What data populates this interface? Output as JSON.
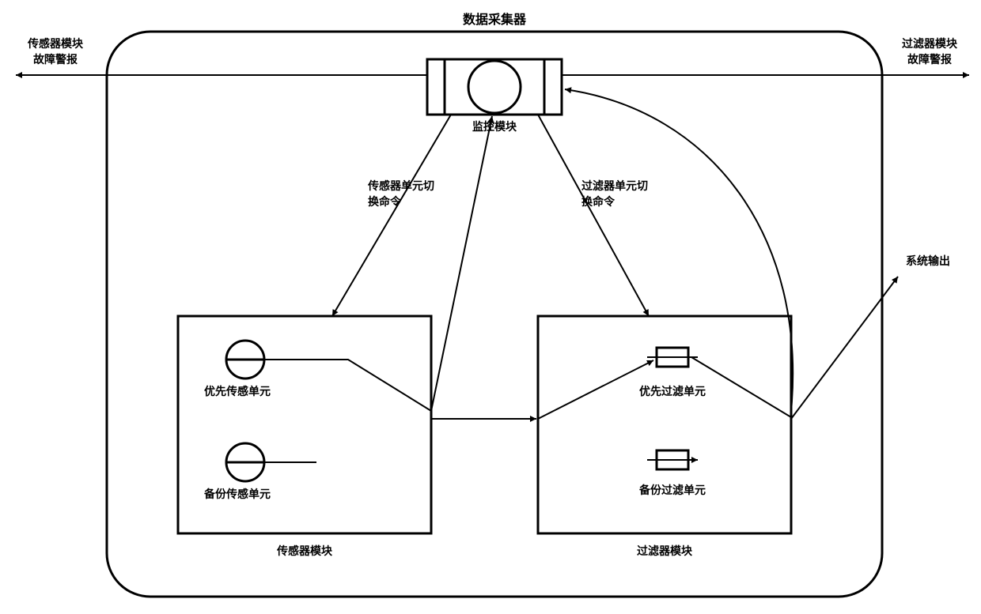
{
  "title": "数据采集器",
  "alarms": {
    "left": {
      "line1": "传感器模块",
      "line2": "故障警报"
    },
    "right": {
      "line1": "过滤器模块",
      "line2": "故障警报"
    }
  },
  "monitor": {
    "label": "监控模块"
  },
  "commands": {
    "sensor_switch": {
      "line1": "传感器单元切",
      "line2": "换命令"
    },
    "filter_switch": {
      "line1": "过滤器单元切",
      "line2": "换命令"
    }
  },
  "sensor_module": {
    "label": "传感器模块",
    "primary": "优先传感单元",
    "backup": "备份传感单元"
  },
  "filter_module": {
    "label": "过滤器模块",
    "primary": "优先过滤单元",
    "backup": "备份过滤单元"
  },
  "output": "系统输出"
}
